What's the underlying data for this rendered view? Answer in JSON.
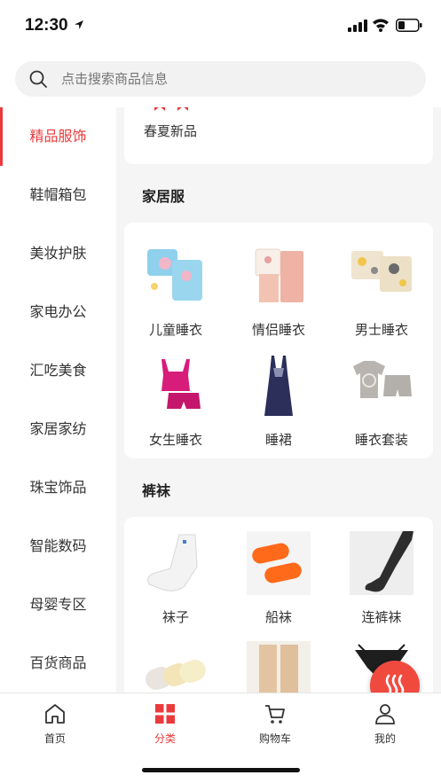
{
  "status_bar": {
    "time": "12:30"
  },
  "search": {
    "placeholder": "点击搜索商品信息"
  },
  "sidebar": {
    "items": [
      {
        "label": "精品服饰",
        "active": true
      },
      {
        "label": "鞋帽箱包"
      },
      {
        "label": "美妆护肤"
      },
      {
        "label": "家电办公"
      },
      {
        "label": "汇吃美食"
      },
      {
        "label": "家居家纺"
      },
      {
        "label": "珠宝饰品"
      },
      {
        "label": "智能数码"
      },
      {
        "label": "母婴专区"
      },
      {
        "label": "百货商品"
      }
    ]
  },
  "main": {
    "top_card": {
      "item_label": "春夏新品"
    },
    "sections": [
      {
        "title": "家居服",
        "items": [
          {
            "label": "儿童睡衣",
            "icon": "kids-pajama-image"
          },
          {
            "label": "情侣睡衣",
            "icon": "couple-pajama-image"
          },
          {
            "label": "男士睡衣",
            "icon": "mens-pajama-image"
          },
          {
            "label": "女生睡衣",
            "icon": "womens-pajama-image"
          },
          {
            "label": "睡裙",
            "icon": "nightgown-image"
          },
          {
            "label": "睡衣套装",
            "icon": "pajama-set-image"
          }
        ]
      },
      {
        "title": "裤袜",
        "items": [
          {
            "label": "袜子",
            "icon": "sock-image"
          },
          {
            "label": "船袜",
            "icon": "boat-sock-image"
          },
          {
            "label": "连裤袜",
            "icon": "pantyhose-image"
          },
          {
            "label": "",
            "icon": "no-show-socks-image"
          },
          {
            "label": "",
            "icon": "tights-image"
          },
          {
            "label": "",
            "icon": "underwear-image"
          }
        ]
      }
    ]
  },
  "tabbar": {
    "tabs": [
      {
        "label": "首页",
        "icon": "home-icon"
      },
      {
        "label": "分类",
        "icon": "category-icon",
        "active": true
      },
      {
        "label": "购物车",
        "icon": "cart-icon"
      },
      {
        "label": "我的",
        "icon": "user-icon"
      }
    ]
  },
  "colors": {
    "accent": "#e93b3d",
    "fab": "#f04a3f",
    "background": "#f5f5f5"
  }
}
